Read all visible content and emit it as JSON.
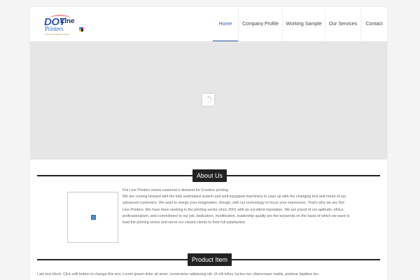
{
  "logo": {
    "dot": "DOT",
    "line": "Line",
    "printers": "Printers",
    "tagline": "a house of quality printing"
  },
  "nav": {
    "items": [
      {
        "label": "Home",
        "active": true
      },
      {
        "label": "Company Profile",
        "active": false
      },
      {
        "label": "Working Sample",
        "active": false
      },
      {
        "label": "Our Services",
        "active": false
      },
      {
        "label": "Contact",
        "active": false
      }
    ]
  },
  "about": {
    "title": "About Us",
    "paragraph1": "Dot Line Printers meets customer’s demand for Creative printing.",
    "paragraph2": "We are coming forward with the fully automated system and well-equipped machinery to cope up with the changing text and mood of our advanced customers. We want to merge your imagination, though, with our technology to focus your expression. That’s why we are Dot Line Printers. We have been working in the printing sector since 2001 with an excellent reputation. We are proud of our aptitude, ethics, professionalism, and commitment to our job, dedication, modification, leadership quality are the keywords on the basis of which we want to lead the printing sector and serve our valued clients to their full satisfaction."
  },
  "product": {
    "title": "Product Item",
    "text": "I am text block. Click edit button to change this text. Lorem ipsum dolor sit amet, consectetur adipiscing elit. Ut elit tellus, luctus nec ullamcorper mattis, pulvinar dapibus leo."
  },
  "colors": {
    "accent": "#2a5db0",
    "heading_bg": "#222222",
    "slider_bg": "#e6e6e6"
  }
}
